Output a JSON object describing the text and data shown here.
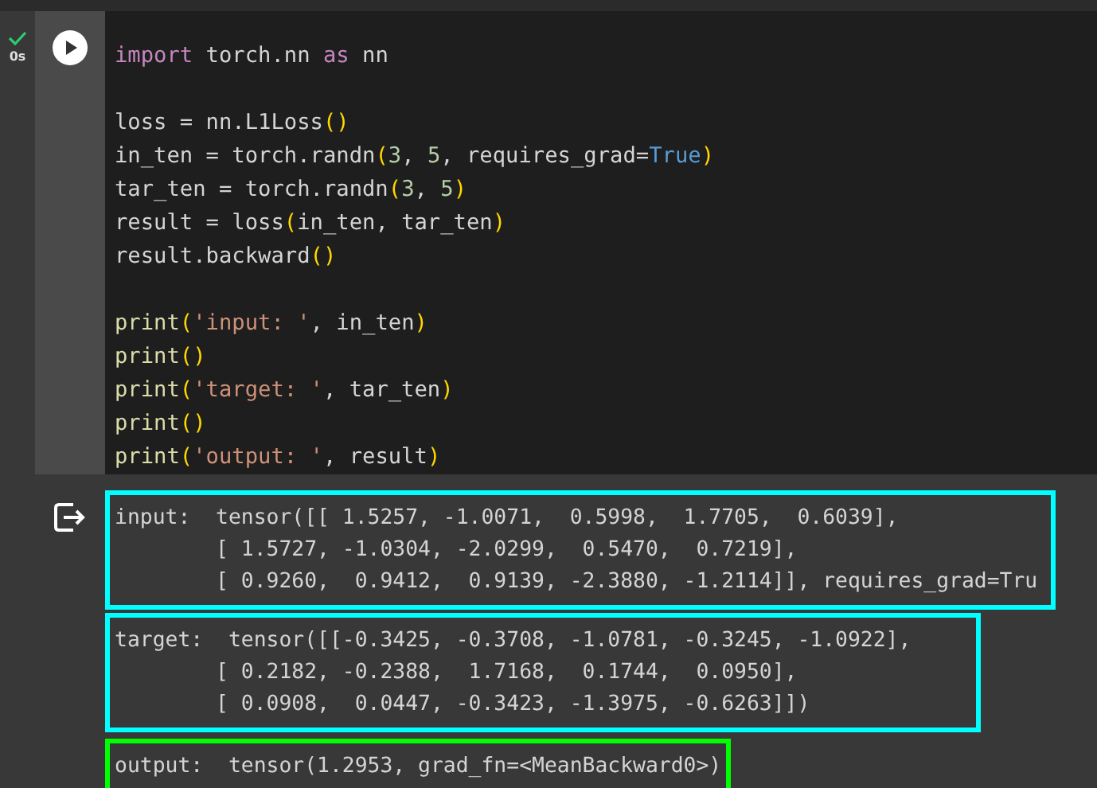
{
  "cell": {
    "status": "0s",
    "done": true,
    "code": [
      {
        "kind": "code",
        "tokens": [
          {
            "kind": "kw",
            "t": "import"
          },
          {
            "kind": "p",
            "t": " torch.nn "
          },
          {
            "kind": "kw",
            "t": "as"
          },
          {
            "kind": "p",
            "t": " nn"
          }
        ]
      },
      {
        "kind": "blank"
      },
      {
        "kind": "code",
        "tokens": [
          {
            "kind": "p",
            "t": "loss = nn.L1Loss"
          },
          {
            "kind": "br",
            "t": "()"
          }
        ]
      },
      {
        "kind": "code",
        "tokens": [
          {
            "kind": "p",
            "t": "in_ten = torch.randn"
          },
          {
            "kind": "br",
            "t": "("
          },
          {
            "kind": "num",
            "t": "3"
          },
          {
            "kind": "p",
            "t": ", "
          },
          {
            "kind": "num",
            "t": "5"
          },
          {
            "kind": "p",
            "t": ", requires_grad="
          },
          {
            "kind": "bool",
            "t": "True"
          },
          {
            "kind": "br",
            "t": ")"
          }
        ]
      },
      {
        "kind": "code",
        "tokens": [
          {
            "kind": "p",
            "t": "tar_ten = torch.randn"
          },
          {
            "kind": "br",
            "t": "("
          },
          {
            "kind": "num",
            "t": "3"
          },
          {
            "kind": "p",
            "t": ", "
          },
          {
            "kind": "num",
            "t": "5"
          },
          {
            "kind": "br",
            "t": ")"
          }
        ]
      },
      {
        "kind": "code",
        "tokens": [
          {
            "kind": "p",
            "t": "result = loss"
          },
          {
            "kind": "br",
            "t": "("
          },
          {
            "kind": "p",
            "t": "in_ten, tar_ten"
          },
          {
            "kind": "br",
            "t": ")"
          }
        ]
      },
      {
        "kind": "code",
        "tokens": [
          {
            "kind": "p",
            "t": "result.backward"
          },
          {
            "kind": "br",
            "t": "()"
          }
        ]
      },
      {
        "kind": "blank"
      },
      {
        "kind": "code",
        "tokens": [
          {
            "kind": "fn",
            "t": "print"
          },
          {
            "kind": "br",
            "t": "("
          },
          {
            "kind": "str",
            "t": "'input: '"
          },
          {
            "kind": "p",
            "t": ", in_ten"
          },
          {
            "kind": "br",
            "t": ")"
          }
        ]
      },
      {
        "kind": "code",
        "tokens": [
          {
            "kind": "fn",
            "t": "print"
          },
          {
            "kind": "br",
            "t": "()"
          }
        ]
      },
      {
        "kind": "code",
        "tokens": [
          {
            "kind": "fn",
            "t": "print"
          },
          {
            "kind": "br",
            "t": "("
          },
          {
            "kind": "str",
            "t": "'target: '"
          },
          {
            "kind": "p",
            "t": ", tar_ten"
          },
          {
            "kind": "br",
            "t": ")"
          }
        ]
      },
      {
        "kind": "code",
        "tokens": [
          {
            "kind": "fn",
            "t": "print"
          },
          {
            "kind": "br",
            "t": "()"
          }
        ]
      },
      {
        "kind": "code",
        "tokens": [
          {
            "kind": "fn",
            "t": "print"
          },
          {
            "kind": "br",
            "t": "("
          },
          {
            "kind": "str",
            "t": "'output: '"
          },
          {
            "kind": "p",
            "t": ", result"
          },
          {
            "kind": "br",
            "t": ")"
          }
        ]
      }
    ],
    "outputs": [
      {
        "color": "#00ffff",
        "lines": [
          "input:  tensor([[ 1.5257, -1.0071,  0.5998,  1.7705,  0.6039],",
          "        [ 1.5727, -1.0304, -2.0299,  0.5470,  0.7219],",
          "        [ 0.9260,  0.9412,  0.9139, -2.3880, -1.2114]], requires_grad=Tru"
        ]
      },
      {
        "color": "#00ffff",
        "lines": [
          "target:  tensor([[-0.3425, -0.3708, -1.0781, -0.3245, -1.0922],",
          "        [ 0.2182, -0.2388,  1.7168,  0.1744,  0.0950],",
          "        [ 0.0908,  0.0447, -0.3423, -1.3975, -0.6263]])"
        ]
      },
      {
        "color": "#00ff00",
        "lines": [
          "output:  tensor(1.2953, grad_fn=<MeanBackward0>)"
        ]
      }
    ]
  }
}
